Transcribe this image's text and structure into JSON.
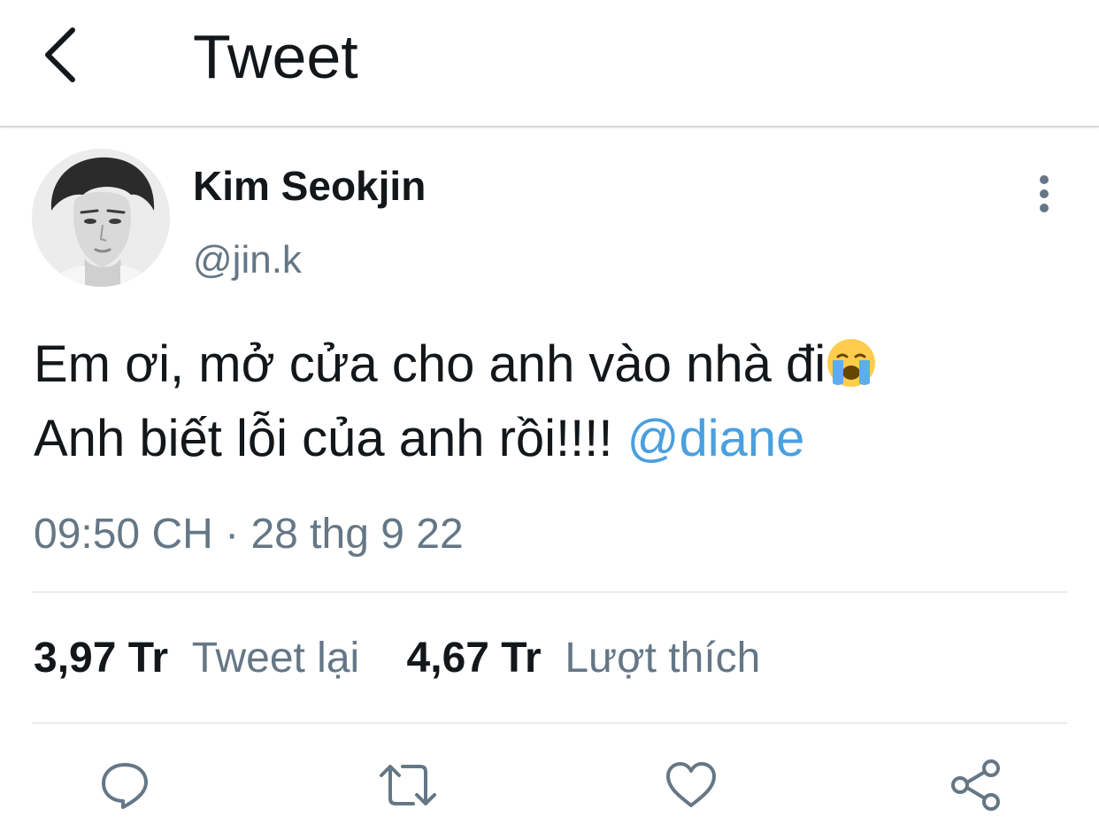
{
  "header": {
    "title": "Tweet",
    "back_icon": "chevron-left-icon"
  },
  "author": {
    "name": "Kim Seokjin",
    "handle": "@jin.k"
  },
  "tweet": {
    "line1": "Em ơi, mở cửa cho anh vào nhà đi",
    "emoji": "crying-face-emoji",
    "line2": "Anh biết lỗi của anh rồi!!!! ",
    "mention": "@diane",
    "time": "09:50 CH · 28 thg 9 22"
  },
  "stats": {
    "retweets_count": "3,97 Tr",
    "retweets_label": "Tweet lại",
    "likes_count": "4,67 Tr",
    "likes_label": "Lượt thích"
  },
  "actions": {
    "reply_icon": "comment-icon",
    "retweet_icon": "retweet-icon",
    "like_icon": "heart-icon",
    "share_icon": "share-icon"
  },
  "colors": {
    "text": "#14171a",
    "secondary": "#657786",
    "link": "#4a9fdf",
    "divider": "#e6ecf0"
  }
}
